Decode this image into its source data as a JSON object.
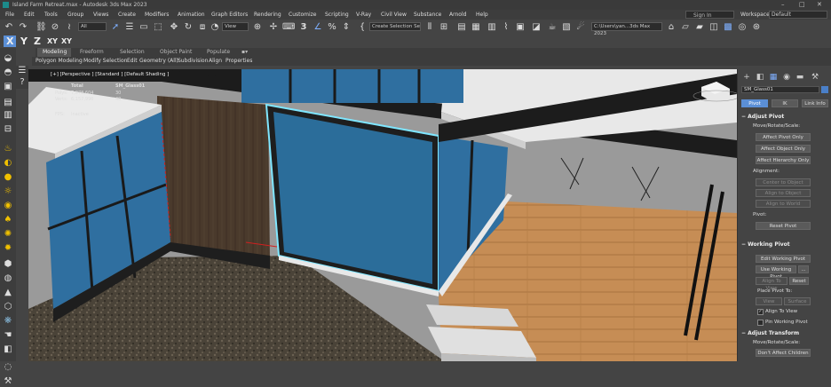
{
  "titlebar": {
    "title": "Island Farm Retreat.max - Autodesk 3ds Max 2023",
    "minimize": "–",
    "maximize": "□",
    "close": "✕"
  },
  "menubar": {
    "items": [
      "File",
      "Edit",
      "Tools",
      "Group",
      "Views",
      "Create",
      "Modifiers",
      "Animation",
      "Graph Editors",
      "Rendering",
      "Customize",
      "Scripting",
      "V-Ray",
      "Civil View",
      "Substance",
      "Arnold",
      "Help"
    ],
    "signin": "Sign In",
    "workspaces_label": "Workspaces:",
    "workspaces_value": "Default"
  },
  "toolbar1": {
    "selection_filter": "All",
    "ref_coord": "View",
    "selection_set": "Create Selection Se",
    "path": "C:\\Users\\yan...3ds Max 2023"
  },
  "toolbar2": {
    "axes": [
      "X",
      "Y",
      "Z",
      "XY",
      "XY"
    ]
  },
  "ribbon": {
    "tabs": [
      "Modeling",
      "Freeform",
      "Selection",
      "Object Paint",
      "Populate"
    ],
    "sub": [
      "Polygon Modeling",
      "Modify Selection",
      "Edit",
      "Geometry (All)",
      "Subdivision",
      "Align",
      "Properties"
    ]
  },
  "viewport": {
    "label": "[+] [Perspective ] [Standard ] [Default Shading ]",
    "stats": {
      "total_label": "Total",
      "object_name": "SM_Glass01",
      "polys_label": "Polys:",
      "polys_total": "7,878,604",
      "polys_obj": "30",
      "verts_label": "Verts:",
      "verts_total": "6,157,996",
      "verts_obj": "40",
      "fps_label": "FPS:",
      "fps_val": "Inactive"
    }
  },
  "command_panel": {
    "object_name": "SM_Glass01",
    "tabs": [
      "Pivot",
      "IK",
      "Link Info"
    ],
    "adjust_pivot": {
      "title": "Adjust Pivot",
      "move_label": "Move/Rotate/Scale:",
      "buttons": [
        "Affect Pivot Only",
        "Affect Object Only",
        "Affect Hierarchy Only"
      ],
      "alignment_label": "Alignment:",
      "align_buttons": [
        "Center to Object",
        "Align to Object",
        "Align to World"
      ],
      "pivot_label": "Pivot:",
      "reset_pivot": "Reset Pivot"
    },
    "working_pivot": {
      "title": "Working Pivot",
      "edit": "Edit Working Pivot",
      "use": "Use Working Pivot",
      "ellipsis": "...",
      "align_to_view": "Align To View",
      "reset": "Reset",
      "place_label": "Place Pivot To:",
      "view": "View",
      "surface": "Surface",
      "align_to_view_cb": "Align To View",
      "pin": "Pin Working Pivot"
    },
    "adjust_transform": {
      "title": "Adjust Transform",
      "move_label": "Move/Rotate/Scale:",
      "dont_affect": "Don't Affect Children"
    }
  },
  "colors": {
    "accent": "#5b8fd6",
    "glass": "#2f6fa0",
    "selection": "#7fe6ff",
    "floor": "#c98f52"
  }
}
